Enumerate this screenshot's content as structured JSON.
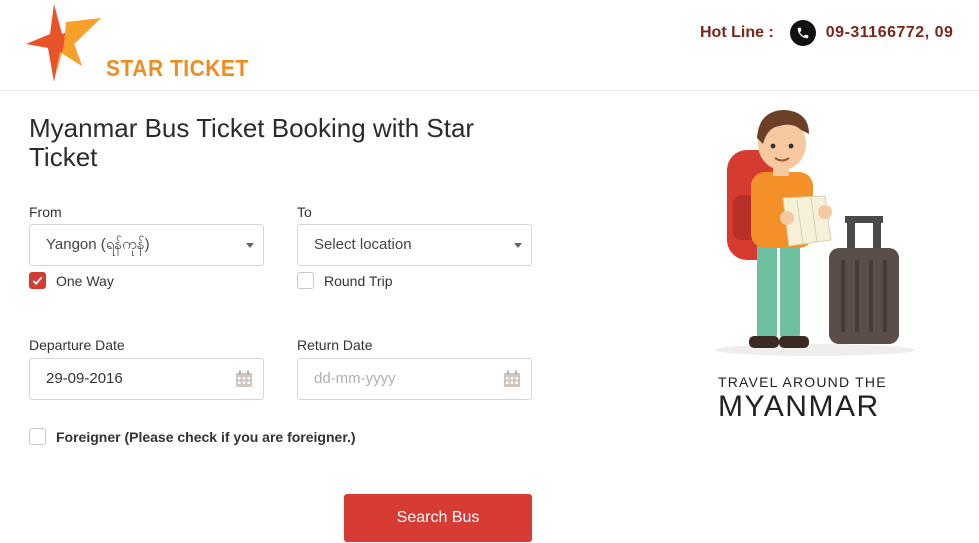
{
  "header": {
    "logo_text": "STAR TICKET",
    "hotline_label": "Hot Line :",
    "hotline_number": "09-31166772, 09"
  },
  "title": "Myanmar Bus Ticket Booking with Star Ticket",
  "form": {
    "from_label": "From",
    "from_value": "Yangon (ရန်ကုန်)",
    "to_label": "To",
    "to_value": "Select location",
    "one_way_label": "One Way",
    "one_way_checked": true,
    "round_trip_label": "Round Trip",
    "round_trip_checked": false,
    "departure_label": "Departure Date",
    "departure_value": "29-09-2016",
    "return_label": "Return Date",
    "return_placeholder": "dd-mm-yyyy",
    "foreigner_label": "Foreigner (Please check if you are foreigner.)",
    "foreigner_checked": false,
    "search_button": "Search Bus"
  },
  "promo": {
    "line1": "TRAVEL AROUND THE",
    "line2": "MYANMAR"
  },
  "colors": {
    "accent_red": "#d63b34",
    "logo_orange": "#ef8c1f",
    "hotline_color": "#7a2618"
  }
}
